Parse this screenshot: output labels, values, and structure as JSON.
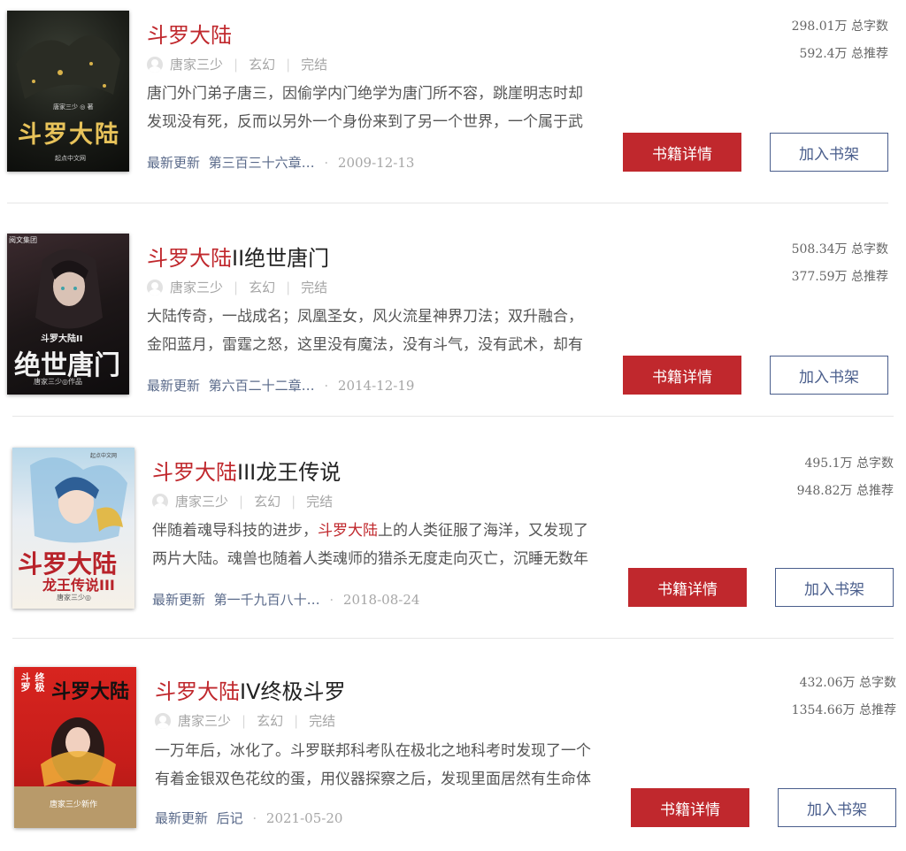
{
  "books": [
    {
      "title_hl": "斗罗大陆",
      "title_rest": "",
      "author": "唐家三少",
      "genre": "玄幻",
      "status": "完结",
      "desc_parts": [
        "唐门外门弟子唐三，因偷学内门绝学为唐门所不容，跳崖明志时却发现没有死，反而以另外一个身份来到了另一个世界，一个属于武魂的世界，名叫斗罗大陆。"
      ],
      "update_label": "最新更新",
      "update_chapter": "第三百三十六章…",
      "update_date": "2009-12-13",
      "words": "298.01万 总字数",
      "recommends": "592.4万 总推荐",
      "detail_label": "书籍详情",
      "shelf_label": "加入书架",
      "cover": {
        "text": "斗罗大陆",
        "author_small": "唐家三少 ◎ 著",
        "publisher": "起点中文网"
      }
    },
    {
      "title_hl": "斗罗大陆",
      "title_rest": "II绝世唐门",
      "author": "唐家三少",
      "genre": "玄幻",
      "status": "完结",
      "desc_parts": [
        "大陆传奇，一战成名；凤凰圣女，风火流星神界刀法；双升融合，金阳蓝月，雷霆之怒，这里没有魔法，没有斗气，没有武术，却有武魂。"
      ],
      "update_label": "最新更新",
      "update_chapter": "第六百二十二章…",
      "update_date": "2014-12-19",
      "words": "508.34万 总字数",
      "recommends": "377.59万 总推荐",
      "detail_label": "书籍详情",
      "shelf_label": "加入书架",
      "cover": {
        "publisher": "阅文集团",
        "series": "斗罗大陆II",
        "text": "绝世唐门",
        "author_small": "唐家三少◎作品"
      }
    },
    {
      "title_hl": "斗罗大陆",
      "title_rest": "III龙王传说",
      "author": "唐家三少",
      "genre": "玄幻",
      "status": "完结",
      "desc_parts": [
        "伴随着魂导科技的进步，",
        "斗罗大陆",
        "上的人类征服了海洋，又发现了两片大陆。魂兽也随着人类魂师的猎杀无度走向灭亡，沉睡无数年的魂兽之王在星斗大森林最后的净土苏醒。"
      ],
      "update_label": "最新更新",
      "update_chapter": "第一千九百八十…",
      "update_date": "2018-08-24",
      "words": "495.1万 总字数",
      "recommends": "948.82万 总推荐",
      "detail_label": "书籍详情",
      "shelf_label": "加入书架",
      "cover": {
        "text": "斗罗大陆",
        "subtext": "龙王传说III",
        "author_small": "唐家三少◎",
        "publisher": "起点中文网"
      }
    },
    {
      "title_hl": "斗罗大陆",
      "title_rest": "IV终极斗罗",
      "author": "唐家三少",
      "genre": "玄幻",
      "status": "完结",
      "desc_parts": [
        "一万年后，冰化了。斗罗联邦科考队在极北之地科考时发现了一个有着金银双色花纹的蛋，用仪器探察之后，发现里面居然有生命体征，赶忙将其带回研究所进行孵化。"
      ],
      "update_label": "最新更新",
      "update_chapter": "后记",
      "update_date": "2021-05-20",
      "words": "432.06万 总字数",
      "recommends": "1354.66万 总推荐",
      "detail_label": "书籍详情",
      "shelf_label": "加入书架",
      "cover": {
        "side_left": "斗罗",
        "side_right": "终极",
        "text": "斗罗大陆",
        "banner": "唐家三少新作"
      }
    }
  ],
  "colors": {
    "accent": "#c0282d",
    "link": "#4a5e8c"
  }
}
